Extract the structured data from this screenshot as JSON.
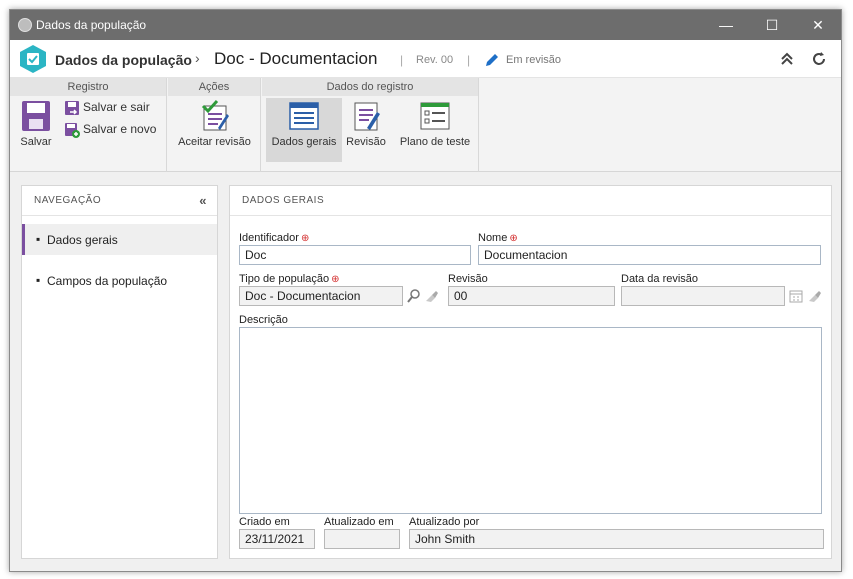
{
  "window": {
    "title": "Dados da população",
    "minimize": "—",
    "maximize": "☐",
    "close": "✕"
  },
  "header": {
    "breadcrumb_parent": "Dados da população",
    "separator": "›",
    "breadcrumb_current": "Doc - Documentacion",
    "revision": "Rev. 00",
    "status": "Em revisão",
    "divider": "|"
  },
  "ribbon": {
    "groups": {
      "registro": "Registro",
      "acoes": "Ações",
      "dados": "Dados do registro"
    },
    "salvar": "Salvar",
    "salvar_sair": "Salvar e sair",
    "salvar_novo": "Salvar e novo",
    "aceitar_revisao": "Aceitar revisão",
    "dados_gerais": "Dados gerais",
    "revisao": "Revisão",
    "plano_teste": "Plano de teste"
  },
  "nav": {
    "title": "NAVEGAÇÃO",
    "collapse": "«",
    "bullet": "▪",
    "items": [
      {
        "label": "Dados gerais",
        "active": true
      },
      {
        "label": "Campos da população",
        "active": false
      }
    ]
  },
  "form": {
    "title": "DADOS GERAIS",
    "identificador_label": "Identificador",
    "identificador_value": "Doc",
    "nome_label": "Nome",
    "nome_value": "Documentacion",
    "tipo_label": "Tipo de população",
    "tipo_value": "Doc - Documentacion",
    "revisao_label": "Revisão",
    "revisao_value": "00",
    "data_revisao_label": "Data da revisão",
    "data_revisao_value": "",
    "descricao_label": "Descrição",
    "descricao_value": "",
    "criado_label": "Criado em",
    "criado_value": "23/11/2021",
    "atualizado_em_label": "Atualizado em",
    "atualizado_em_value": "",
    "atualizado_por_label": "Atualizado por",
    "atualizado_por_value": "John Smith",
    "required_mark": "⊕"
  },
  "colors": {
    "accent": "#7b4fa0",
    "titlebar": "#6d6d6d",
    "required": "#d32f2f",
    "logo": "#2bb5c4"
  }
}
